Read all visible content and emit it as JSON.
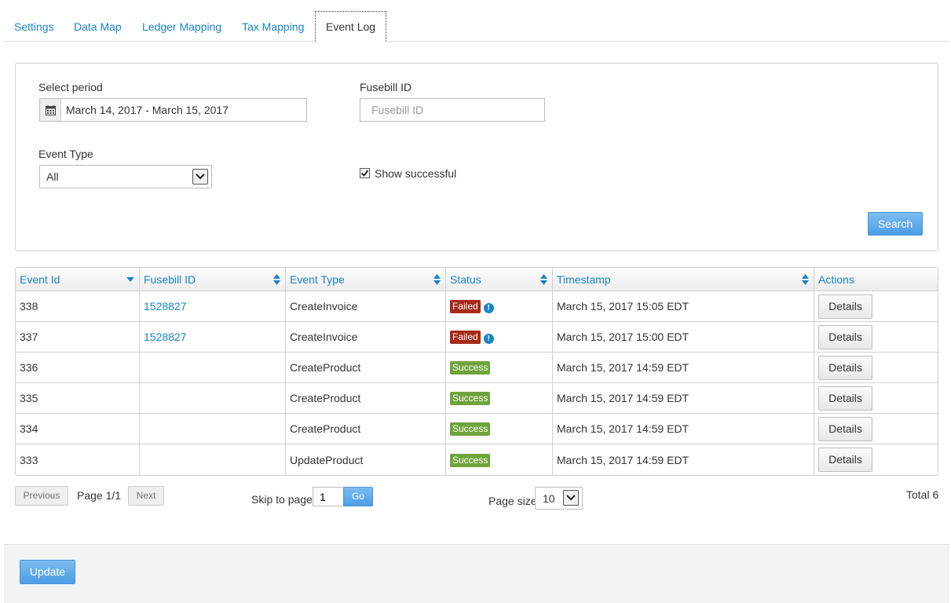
{
  "tabs": [
    {
      "label": "Settings"
    },
    {
      "label": "Data Map"
    },
    {
      "label": "Ledger Mapping"
    },
    {
      "label": "Tax Mapping"
    },
    {
      "label": "Event Log"
    }
  ],
  "filters": {
    "period_label": "Select period",
    "period_value": "March 14, 2017 - March 15, 2017",
    "fusebill_label": "Fusebill ID",
    "fusebill_placeholder": "Fusebill ID",
    "event_type_label": "Event Type",
    "event_type_value": "All",
    "show_successful_label": "Show successful",
    "show_successful_checked": true,
    "search_label": "Search"
  },
  "table": {
    "columns": [
      "Event Id",
      "Fusebill ID",
      "Event Type",
      "Status",
      "Timestamp",
      "Actions"
    ],
    "rows": [
      {
        "id": "338",
        "fusebill": "1528827",
        "type": "CreateInvoice",
        "status": "Failed",
        "timestamp": "March 15, 2017 15:05 EDT",
        "action": "Details"
      },
      {
        "id": "337",
        "fusebill": "1528827",
        "type": "CreateInvoice",
        "status": "Failed",
        "timestamp": "March 15, 2017 15:00 EDT",
        "action": "Details"
      },
      {
        "id": "336",
        "fusebill": "",
        "type": "CreateProduct",
        "status": "Success",
        "timestamp": "March 15, 2017 14:59 EDT",
        "action": "Details"
      },
      {
        "id": "335",
        "fusebill": "",
        "type": "CreateProduct",
        "status": "Success",
        "timestamp": "March 15, 2017 14:59 EDT",
        "action": "Details"
      },
      {
        "id": "334",
        "fusebill": "",
        "type": "CreateProduct",
        "status": "Success",
        "timestamp": "March 15, 2017 14:59 EDT",
        "action": "Details"
      },
      {
        "id": "333",
        "fusebill": "",
        "type": "UpdateProduct",
        "status": "Success",
        "timestamp": "March 15, 2017 14:59 EDT",
        "action": "Details"
      }
    ]
  },
  "pager": {
    "previous_label": "Previous",
    "page_text": "Page 1/1",
    "next_label": "Next",
    "skip_label": "Skip to page",
    "skip_value": "1",
    "go_label": "Go",
    "page_size_label": "Page size",
    "page_size_value": "10",
    "total_text": "Total 6"
  },
  "footer": {
    "update_label": "Update"
  },
  "colors": {
    "link": "#1a84c7",
    "failed": "#a52a1a",
    "success": "#6fa33c",
    "primary_button": "#4c9de6"
  }
}
